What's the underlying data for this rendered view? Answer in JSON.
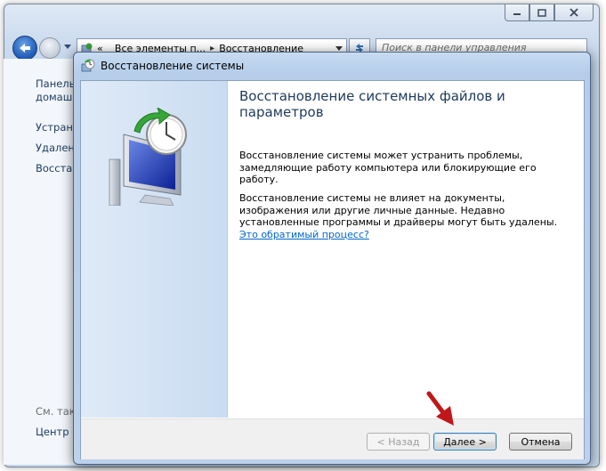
{
  "background_window": {
    "breadcrumb": [
      "Все элементы п...",
      "Восстановление"
    ],
    "breadcrumb_prefix": "«",
    "search_placeholder": "Поиск в панели управления",
    "side_items": [
      "Панель",
      "домаш",
      "Устран",
      "Удален",
      "Восстан",
      "См. так",
      "Центр"
    ]
  },
  "dialog": {
    "title": "Восстановление системы",
    "heading": "Восстановление системных файлов и параметров",
    "para1": "Восстановление системы может устранить проблемы, замедляющие работу компьютера или блокирующие его работу.",
    "para2": "Восстановление системы не влияет на документы, изображения или другие личные данные. Недавно установленные программы и драйверы могут быть удалены.",
    "link": "Это обратимый процесс?",
    "buttons": {
      "back": "< Назад",
      "next": "Далее >",
      "cancel": "Отмена"
    }
  },
  "colors": {
    "annotation_arrow": "#c0171b",
    "link": "#0066cc",
    "heading": "#1e395b"
  },
  "icons": [
    "back-arrow-icon",
    "forward-arrow-icon",
    "control-panel-icon",
    "refresh-icon",
    "system-restore-icon",
    "computer-restore-icon"
  ]
}
